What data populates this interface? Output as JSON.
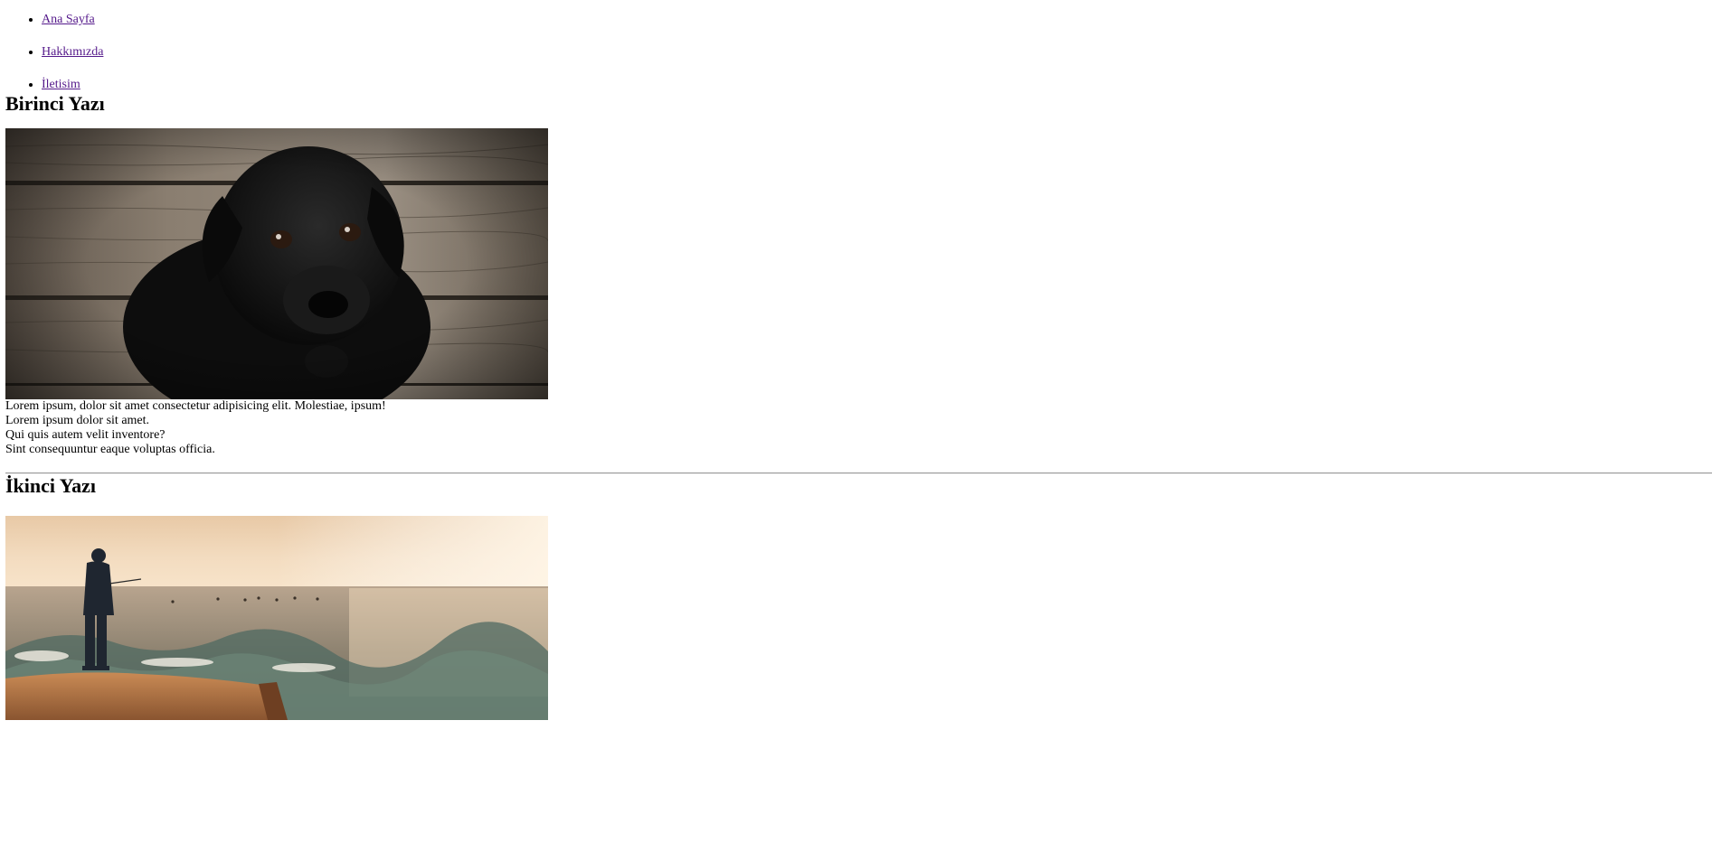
{
  "nav": {
    "items": [
      {
        "label": "Ana Sayfa"
      },
      {
        "label": "Hakkımızda"
      },
      {
        "label": "İletisim"
      }
    ]
  },
  "posts": [
    {
      "title": "Birinci Yazı",
      "image_alt": "black puppy on wooden floor",
      "paragraphs": [
        "Lorem ipsum, dolor sit amet consectetur adipisicing elit. Molestiae, ipsum!",
        "Lorem ipsum dolor sit amet.",
        "Qui quis autem velit inventore?",
        "Sint consequuntur eaque voluptas officia."
      ]
    },
    {
      "title": "İkinci Yazı",
      "image_alt": "man fishing by the sea at sunset"
    }
  ],
  "colors": {
    "link_visited": "#551a8b",
    "text": "#000000",
    "background": "#ffffff"
  }
}
